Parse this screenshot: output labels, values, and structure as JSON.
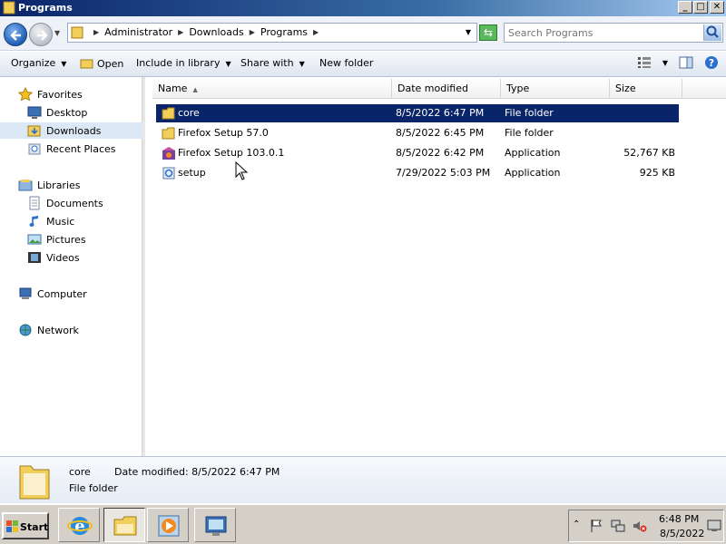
{
  "window": {
    "title": "Programs"
  },
  "address": {
    "crumbs": [
      "Administrator",
      "Downloads",
      "Programs"
    ]
  },
  "search": {
    "placeholder": "Search Programs"
  },
  "commands": {
    "organize": "Organize",
    "open": "Open",
    "include_in_library": "Include in library",
    "share_with": "Share with",
    "new_folder": "New folder"
  },
  "nav": {
    "favorites": "Favorites",
    "desktop": "Desktop",
    "downloads": "Downloads",
    "recent_places": "Recent Places",
    "libraries": "Libraries",
    "documents": "Documents",
    "music": "Music",
    "pictures": "Pictures",
    "videos": "Videos",
    "computer": "Computer",
    "network": "Network"
  },
  "columns": {
    "name": "Name",
    "date_modified": "Date modified",
    "type": "Type",
    "size": "Size"
  },
  "files": [
    {
      "name": "core",
      "date": "8/5/2022 6:47 PM",
      "type": "File folder",
      "size": "",
      "icon": "folder-icon"
    },
    {
      "name": "Firefox Setup 57.0",
      "date": "8/5/2022 6:45 PM",
      "type": "File folder",
      "size": "",
      "icon": "folder-icon"
    },
    {
      "name": "Firefox Setup 103.0.1",
      "date": "8/5/2022 6:42 PM",
      "type": "Application",
      "size": "52,767 KB",
      "icon": "firefox-installer-icon"
    },
    {
      "name": "setup",
      "date": "7/29/2022 5:03 PM",
      "type": "Application",
      "size": "925 KB",
      "icon": "setup-icon"
    }
  ],
  "details": {
    "name": "core",
    "modified": "Date modified:  8/5/2022 6:47 PM",
    "type": "File folder"
  },
  "taskbar": {
    "start": "Start",
    "time": "6:48 PM",
    "date": "8/5/2022"
  },
  "colors": {
    "selection": "#0a246a",
    "titlebar": "#0a246a"
  }
}
